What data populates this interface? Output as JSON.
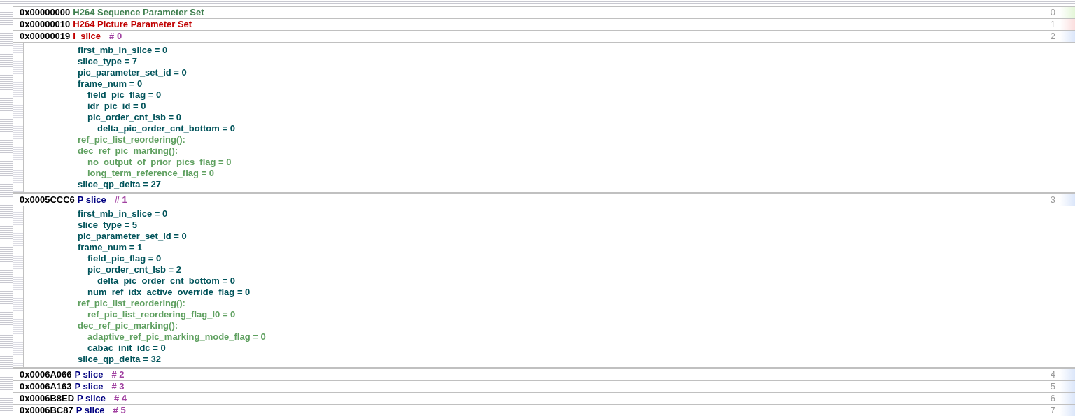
{
  "units": [
    {
      "offset": "0x00000000",
      "type": "H264 Sequence Parameter Set",
      "color": "#3f7f4f",
      "kind": "sps",
      "index": "0"
    },
    {
      "offset": "0x00000010",
      "type": "H264 Picture Parameter Set",
      "color": "#c00000",
      "kind": "pps",
      "index": "1"
    },
    {
      "offset": "0x00000019",
      "type": "I  slice",
      "color": "#c00000",
      "number": "# 0",
      "kind": "slice",
      "index": "2",
      "fields": [
        {
          "text": "first_mb_in_slice = 0",
          "kind": "syntax"
        },
        {
          "text": "slice_type = 7",
          "kind": "syntax"
        },
        {
          "text": "pic_parameter_set_id = 0",
          "kind": "syntax"
        },
        {
          "text": "frame_num = 0",
          "kind": "syntax",
          "children": [
            {
              "text": "field_pic_flag = 0",
              "kind": "syntax"
            },
            {
              "text": "idr_pic_id = 0",
              "kind": "syntax"
            },
            {
              "text": "pic_order_cnt_lsb = 0",
              "kind": "syntax",
              "children": [
                {
                  "text": "delta_pic_order_cnt_bottom = 0",
                  "kind": "syntax"
                }
              ]
            }
          ]
        },
        {
          "text": "ref_pic_list_reordering():",
          "kind": "ref"
        },
        {
          "text": "dec_ref_pic_marking():",
          "kind": "ref",
          "children": [
            {
              "text": "no_output_of_prior_pics_flag = 0",
              "kind": "ref"
            },
            {
              "text": "long_term_reference_flag = 0",
              "kind": "ref"
            }
          ]
        },
        {
          "text": "slice_qp_delta = 27",
          "kind": "syntax"
        }
      ]
    },
    {
      "offset": "0x0005CCC6",
      "type": "P slice",
      "color": "#000080",
      "number": "# 1",
      "kind": "slice",
      "index": "3",
      "fields": [
        {
          "text": "first_mb_in_slice = 0",
          "kind": "syntax"
        },
        {
          "text": "slice_type = 5",
          "kind": "syntax"
        },
        {
          "text": "pic_parameter_set_id = 0",
          "kind": "syntax"
        },
        {
          "text": "frame_num = 1",
          "kind": "syntax",
          "children": [
            {
              "text": "field_pic_flag = 0",
              "kind": "syntax"
            },
            {
              "text": "pic_order_cnt_lsb = 2",
              "kind": "syntax",
              "children": [
                {
                  "text": "delta_pic_order_cnt_bottom = 0",
                  "kind": "syntax"
                }
              ]
            },
            {
              "text": "num_ref_idx_active_override_flag = 0",
              "kind": "syntax"
            }
          ]
        },
        {
          "text": "ref_pic_list_reordering():",
          "kind": "ref",
          "children": [
            {
              "text": "ref_pic_list_reordering_flag_l0 = 0",
              "kind": "ref"
            }
          ]
        },
        {
          "text": "dec_ref_pic_marking():",
          "kind": "ref",
          "children": [
            {
              "text": "adaptive_ref_pic_marking_mode_flag = 0",
              "kind": "ref"
            },
            {
              "text": "cabac_init_idc = 0",
              "kind": "syntax"
            }
          ]
        },
        {
          "text": "slice_qp_delta = 32",
          "kind": "syntax"
        }
      ]
    },
    {
      "offset": "0x0006A066",
      "type": "P slice",
      "color": "#000080",
      "number": "# 2",
      "kind": "slice",
      "index": "4"
    },
    {
      "offset": "0x0006A163",
      "type": "P slice",
      "color": "#000080",
      "number": "# 3",
      "kind": "slice",
      "index": "5"
    },
    {
      "offset": "0x0006B8ED",
      "type": "P slice",
      "color": "#000080",
      "number": "# 4",
      "kind": "slice",
      "index": "6"
    },
    {
      "offset": "0x0006BC87",
      "type": "P slice",
      "color": "#000080",
      "number": "# 5",
      "kind": "slice",
      "index": "7"
    }
  ]
}
